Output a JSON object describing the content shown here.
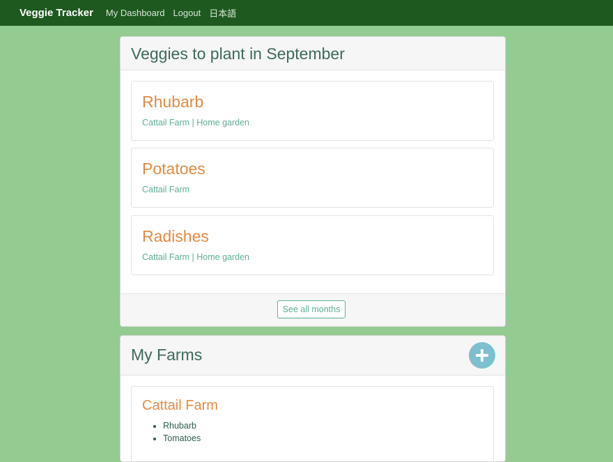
{
  "navbar": {
    "brand": "Veggie Tracker",
    "links": [
      "My Dashboard",
      "Logout",
      "日本語"
    ]
  },
  "veggies_panel": {
    "title": "Veggies to plant in September",
    "items": [
      {
        "name": "Rhubarb",
        "locations": "Cattail Farm | Home garden"
      },
      {
        "name": "Potatoes",
        "locations": "Cattail Farm"
      },
      {
        "name": "Radishes",
        "locations": "Cattail Farm | Home garden"
      }
    ],
    "footer_button": "See all months"
  },
  "farms_panel": {
    "title": "My Farms",
    "add_icon": "plus-icon",
    "farms": [
      {
        "name": "Cattail Farm",
        "veggies": [
          "Rhubarb",
          "Tomatoes"
        ]
      }
    ]
  },
  "colors": {
    "page_bg": "#93cb90",
    "navbar_bg": "#1e5920",
    "accent_orange": "#e08c44",
    "accent_teal": "#5fae98",
    "add_button": "#7ebfcf"
  }
}
